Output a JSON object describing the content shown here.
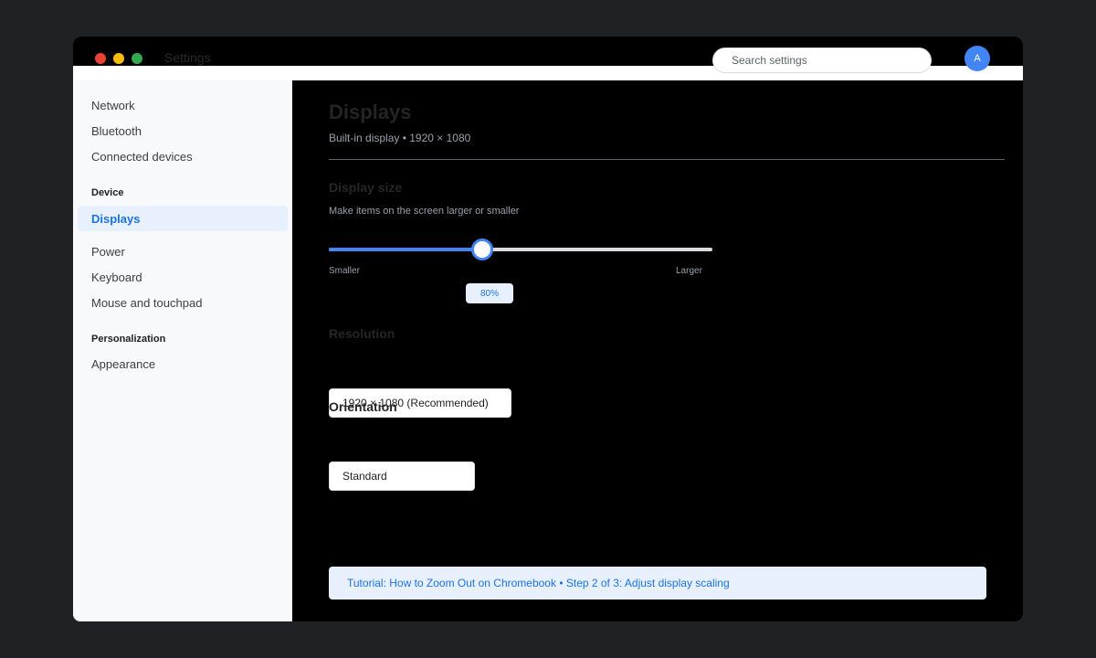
{
  "window": {
    "app_title": "Settings",
    "search_placeholder": "Search settings",
    "avatar_initial": "A"
  },
  "sidebar": {
    "items_top": [
      {
        "label": "Network"
      },
      {
        "label": "Bluetooth"
      },
      {
        "label": "Connected devices"
      }
    ],
    "section_device": "Device",
    "active_item": "Displays",
    "items_device": [
      {
        "label": "Power"
      },
      {
        "label": "Keyboard"
      },
      {
        "label": "Mouse and touchpad"
      }
    ],
    "section_personalization": "Personalization",
    "items_personalization": [
      {
        "label": "Appearance"
      }
    ]
  },
  "main": {
    "title": "Displays",
    "subtitle": "Built-in display • 1920 × 1080",
    "display_size": {
      "title": "Display size",
      "description": "Make items on the screen larger or smaller",
      "min_label": "Smaller",
      "max_label": "Larger",
      "value_label": "80%",
      "slider_fraction": 0.4
    },
    "resolution": {
      "title": "Resolution",
      "selected": "1920 × 1080 (Recommended)"
    },
    "orientation": {
      "title": "Orientation",
      "selected": "Standard"
    },
    "tutorial": "Tutorial: How to Zoom Out on Chromebook • Step 2 of 3: Adjust display scaling"
  },
  "colors": {
    "accent": "#4285f4",
    "active_text": "#1a73e8",
    "active_bg": "#e8f0fe"
  }
}
